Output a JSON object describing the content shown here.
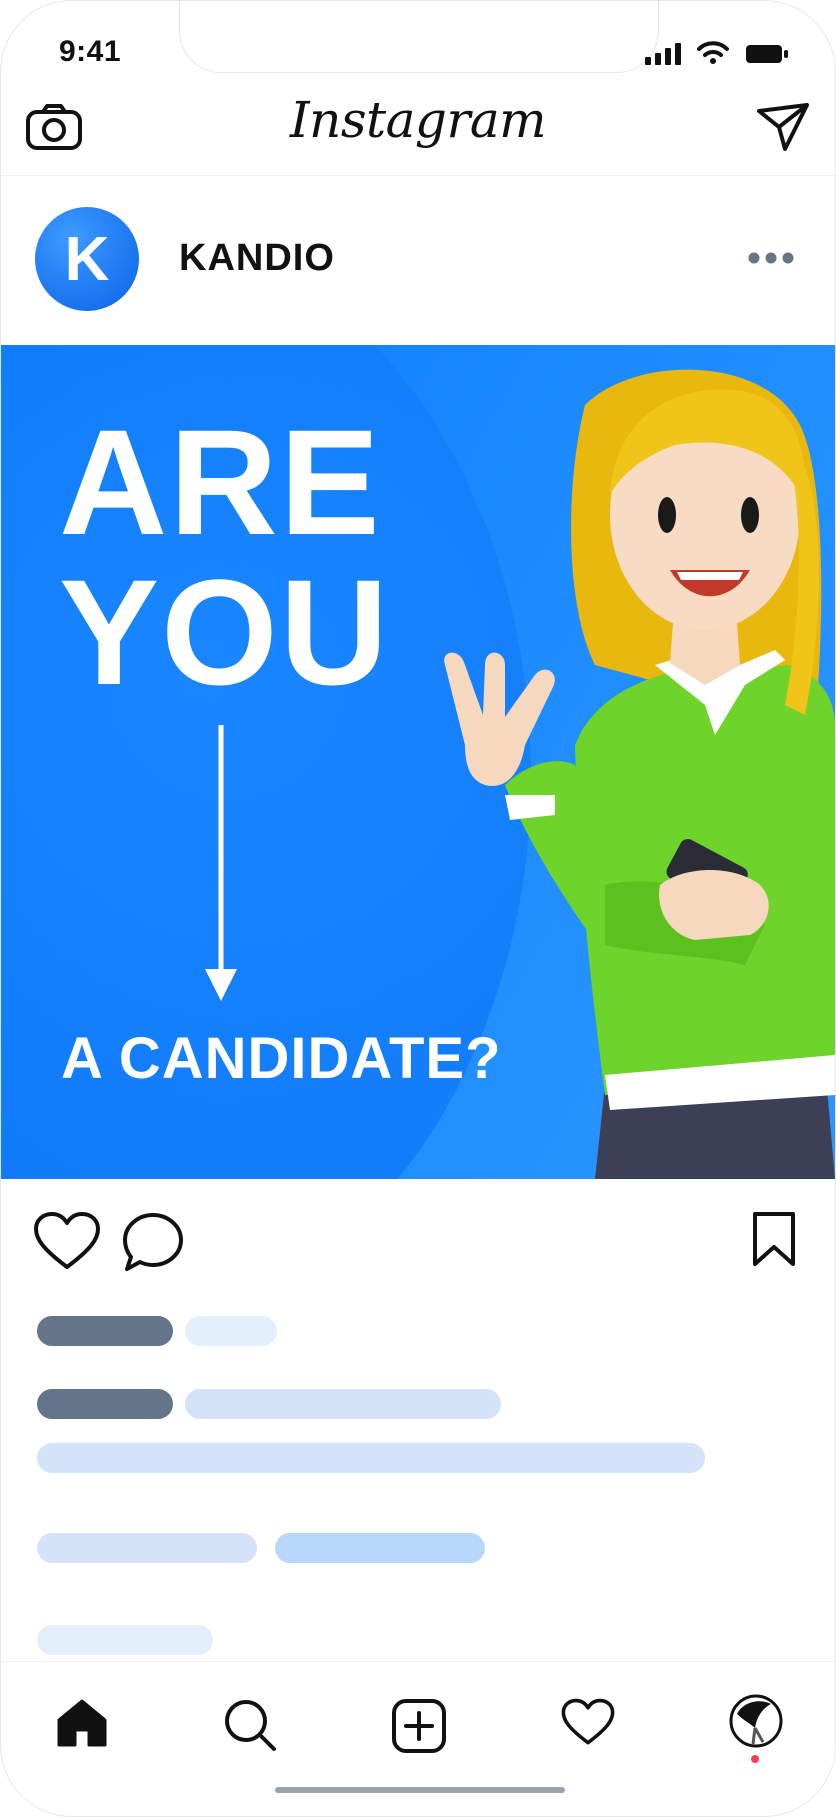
{
  "status_bar": {
    "time": "9:41"
  },
  "top_bar": {
    "logo": "Instagram"
  },
  "post": {
    "username": "KANDIO",
    "avatar_letter": "K",
    "image": {
      "headline_line1": "ARE",
      "headline_line2": "YOU",
      "subline": "A CANDIDATE?"
    }
  },
  "colors": {
    "brand_blue": "#0a7bff",
    "sweater_green": "#6ed32a",
    "placeholder_dark": "#64748b",
    "placeholder_light": "#d4e3f7",
    "placeholder_accent": "#b7d7fb"
  },
  "icons": {
    "camera": "camera-icon",
    "send": "send-icon",
    "more": "more-icon",
    "like": "heart-icon",
    "comment": "comment-icon",
    "save": "bookmark-icon",
    "home": "home-icon",
    "search": "search-icon",
    "add": "add-post-icon",
    "activity": "heart-icon",
    "profile": "profile-avatar"
  }
}
